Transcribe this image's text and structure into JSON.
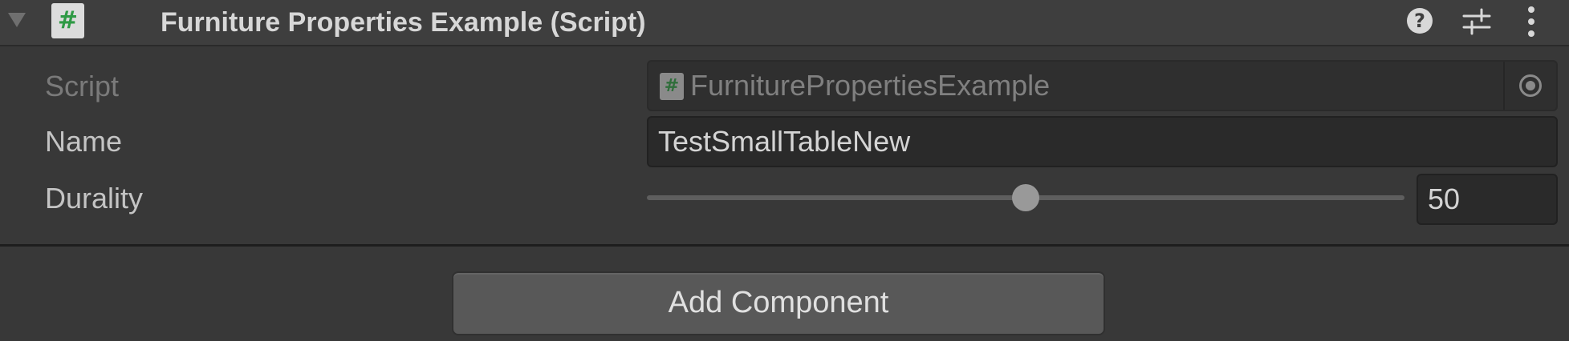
{
  "component": {
    "title": "Furniture Properties Example (Script)",
    "icon": "csharp-script-icon",
    "header_icons": [
      "help-icon",
      "presets-icon",
      "more-menu-icon"
    ]
  },
  "fields": {
    "script": {
      "label": "Script",
      "value": "FurniturePropertiesExample",
      "icon": "csharp-script-icon"
    },
    "name": {
      "label": "Name",
      "value": "TestSmallTableNew"
    },
    "durality": {
      "label": "Durality",
      "value": "50",
      "slider_fraction": 0.5
    }
  },
  "buttons": {
    "add_component": "Add Component"
  },
  "glyphs": {
    "hash": "#",
    "help": "?"
  },
  "colors": {
    "background": "#383838",
    "header": "#3e3e3e",
    "field": "#2a2a2a",
    "button": "#585858",
    "script_icon_green": "#2f9a45"
  }
}
